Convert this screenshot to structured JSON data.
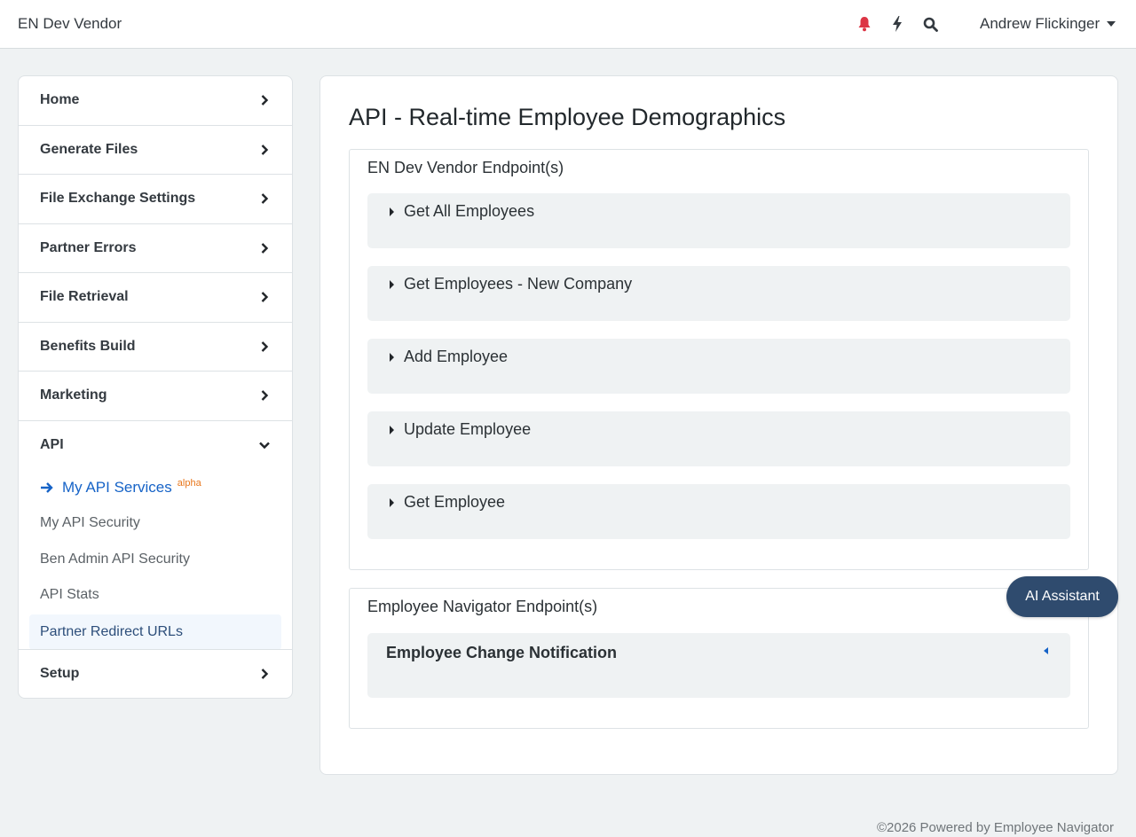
{
  "header": {
    "brand": "EN Dev Vendor",
    "user_name": "Andrew Flickinger",
    "icons": [
      "bell-icon",
      "bolt-icon",
      "search-icon"
    ],
    "bell_color": "#dc3545"
  },
  "sidebar": {
    "items": [
      {
        "label": "Home"
      },
      {
        "label": "Generate Files"
      },
      {
        "label": "File Exchange Settings"
      },
      {
        "label": "Partner Errors"
      },
      {
        "label": "File Retrieval"
      },
      {
        "label": "Benefits Build"
      },
      {
        "label": "Marketing"
      }
    ],
    "api": {
      "label": "API",
      "subitems": [
        {
          "label": "My API Services",
          "badge": "alpha"
        },
        {
          "label": "My API Security"
        },
        {
          "label": "Ben Admin API Security"
        },
        {
          "label": "API Stats"
        },
        {
          "label": "Partner Redirect URLs"
        }
      ]
    },
    "setup": {
      "label": "Setup"
    }
  },
  "main": {
    "title": "API - Real-time Employee Demographics",
    "groups": [
      {
        "title": "EN Dev Vendor Endpoint(s)",
        "endpoints": [
          "Get All Employees",
          "Get Employees - New Company",
          "Add Employee",
          "Update Employee",
          "Get Employee"
        ]
      },
      {
        "title": "Employee Navigator Endpoint(s)",
        "endpoints": [
          "Employee Change Notification"
        ]
      }
    ]
  },
  "ai_assistant_label": "AI Assistant",
  "footer": "©2026 Powered by Employee Navigator",
  "colors": {
    "accent": "#1663c7",
    "ai_button": "#2f4b6e",
    "alpha_badge": "#e8761b"
  }
}
